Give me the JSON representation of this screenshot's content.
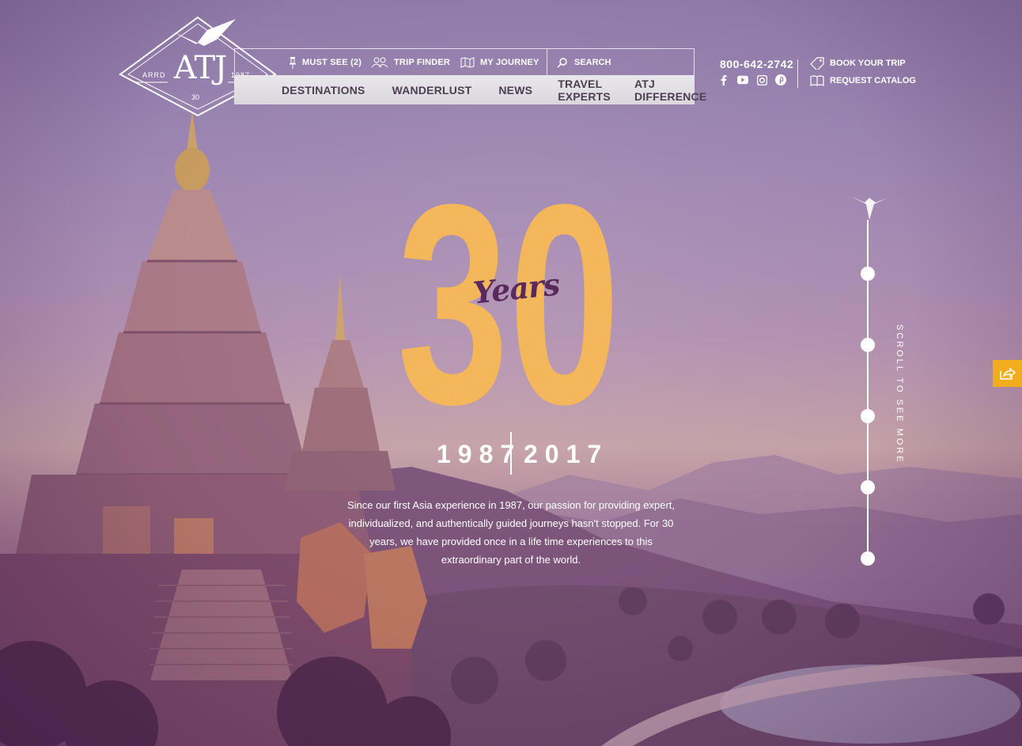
{
  "brand": {
    "logo_main": "ATJ",
    "logo_left": "ARRD",
    "logo_right": "1987",
    "logo_bottom": "30"
  },
  "topbar": {
    "must_see": "MUST SEE (2)",
    "trip_finder": "TRIP FINDER",
    "my_journey": "MY JOURNEY",
    "search_placeholder": "SEARCH"
  },
  "mainnav": {
    "items": [
      "DESTINATIONS",
      "WANDERLUST",
      "NEWS",
      "TRAVEL EXPERTS",
      "ATJ DIFFERENCE"
    ]
  },
  "contact": {
    "phone": "800-642-2742",
    "social": [
      "facebook-icon",
      "youtube-icon",
      "instagram-icon",
      "pinterest-icon"
    ]
  },
  "cta": {
    "book": "BOOK YOUR TRIP",
    "catalog": "REQUEST CATALOG"
  },
  "hero": {
    "number": "30",
    "script": "Years",
    "year_start": "1987",
    "year_end": "2017",
    "description": "Since our first Asia experience in 1987, our passion for providing expert, individualized, and authentically guided journeys hasn't stopped. For 30 years, we have provided once in a life time experiences to this extraordinary part of the world."
  },
  "scroll": {
    "label": "SCROLL TO SEE MORE",
    "dots": 5
  },
  "colors": {
    "accent": "#f2ad1f",
    "nav_text": "#4b3f50",
    "script": "#5b2a5c"
  }
}
